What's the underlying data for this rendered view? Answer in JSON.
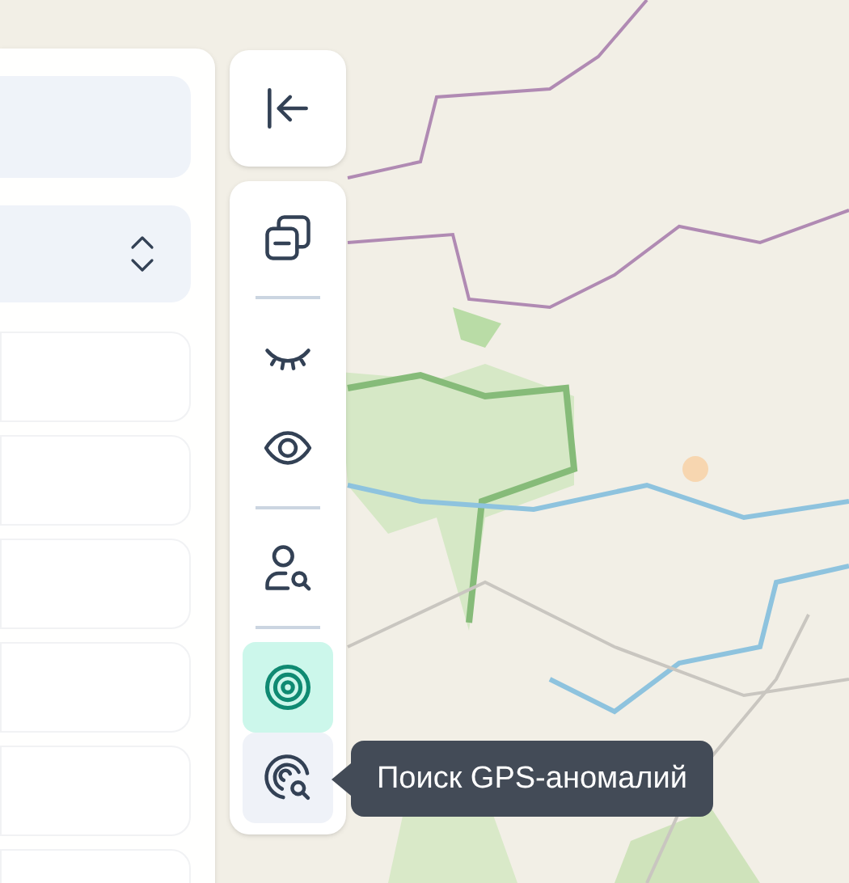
{
  "panel": {
    "items": [
      {
        "kind": "field"
      },
      {
        "kind": "select"
      },
      {
        "kind": "card"
      },
      {
        "kind": "card"
      },
      {
        "kind": "card"
      },
      {
        "kind": "card"
      },
      {
        "kind": "card"
      },
      {
        "kind": "card"
      }
    ]
  },
  "toolbar": {
    "groups": [
      {
        "tools": [
          {
            "kind": "collapse",
            "selected": false,
            "hovered": false
          }
        ]
      },
      {
        "tools": [
          {
            "kind": "layers",
            "selected": false,
            "hovered": false
          },
          {
            "kind": "divider"
          },
          {
            "kind": "hide",
            "selected": false,
            "hovered": false
          },
          {
            "kind": "show",
            "selected": false,
            "hovered": false
          },
          {
            "kind": "divider"
          },
          {
            "kind": "user-search",
            "selected": false,
            "hovered": false
          },
          {
            "kind": "divider"
          },
          {
            "kind": "target",
            "selected": true,
            "hovered": false
          },
          {
            "kind": "radar-search",
            "selected": false,
            "hovered": true
          }
        ]
      }
    ]
  },
  "tooltip": {
    "text": "Поиск GPS-аномалий"
  }
}
